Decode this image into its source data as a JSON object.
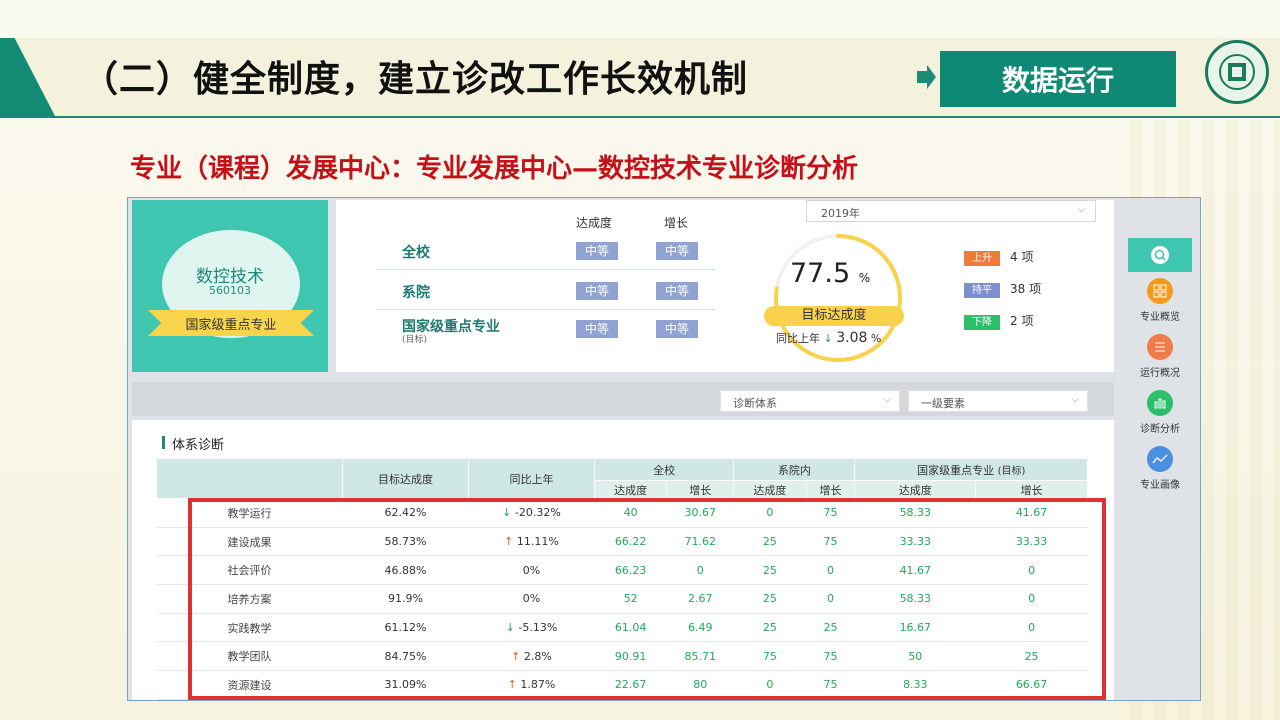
{
  "slide": {
    "title": "（二）健全制度，建立诊改工作长效机制",
    "badge": "数据运行",
    "subtitle": "专业（课程）发展中心：专业发展中心—数控技术专业诊断分析",
    "logo_icon": "school-seal-icon"
  },
  "major": {
    "name": "数控技术",
    "code": "560103",
    "ribbon": "国家级重点专业"
  },
  "levels": {
    "col_achieve": "达成度",
    "col_growth": "增长",
    "rows": [
      {
        "label": "全校",
        "sub": "",
        "achieve": "中等",
        "growth": "中等"
      },
      {
        "label": "系院",
        "sub": "",
        "achieve": "中等",
        "growth": "中等"
      },
      {
        "label": "国家级重点专业",
        "sub": "(目标)",
        "achieve": "中等",
        "growth": "中等"
      }
    ]
  },
  "year_select": {
    "value": "2019年"
  },
  "gauge": {
    "value": "77.5",
    "unit": "%",
    "label": "目标达成度",
    "yoy_prefix": "同比上年",
    "yoy_value": "3.08",
    "yoy_unit": "%",
    "fill_fraction": 0.775
  },
  "stats": [
    {
      "chip": "上升",
      "text": "4 项",
      "color": "#f07a3c"
    },
    {
      "chip": "持平",
      "text": "38 项",
      "color": "#7e8fd0"
    },
    {
      "chip": "下降",
      "text": "2 项",
      "color": "#2bbf6a"
    }
  ],
  "filters": {
    "system": "诊断体系",
    "level": "一级要素"
  },
  "section_title": "体系诊断",
  "table": {
    "h_target": "目标达成度",
    "h_yoy": "同比上年",
    "h_school": "全校",
    "h_dept": "系院内",
    "h_national": "国家级重点专业",
    "h_national_note": "(目标)",
    "h_achieve": "达成度",
    "h_growth": "增长",
    "rows": [
      {
        "name": "教学运行",
        "target": "62.42%",
        "dir": "down",
        "yoy": "-20.32%",
        "s_a": "40",
        "s_g": "30.67",
        "d_a": "0",
        "d_g": "75",
        "n_a": "58.33",
        "n_g": "41.67"
      },
      {
        "name": "建设成果",
        "target": "58.73%",
        "dir": "up",
        "yoy": "11.11%",
        "s_a": "66.22",
        "s_g": "71.62",
        "d_a": "25",
        "d_g": "75",
        "n_a": "33.33",
        "n_g": "33.33"
      },
      {
        "name": "社会评价",
        "target": "46.88%",
        "dir": "none",
        "yoy": "0%",
        "s_a": "66.23",
        "s_g": "0",
        "d_a": "25",
        "d_g": "0",
        "n_a": "41.67",
        "n_g": "0"
      },
      {
        "name": "培养方案",
        "target": "91.9%",
        "dir": "none",
        "yoy": "0%",
        "s_a": "52",
        "s_g": "2.67",
        "d_a": "25",
        "d_g": "0",
        "n_a": "58.33",
        "n_g": "0"
      },
      {
        "name": "实践教学",
        "target": "61.12%",
        "dir": "down",
        "yoy": "-5.13%",
        "s_a": "61.04",
        "s_g": "6.49",
        "d_a": "25",
        "d_g": "25",
        "n_a": "16.67",
        "n_g": "0"
      },
      {
        "name": "教学团队",
        "target": "84.75%",
        "dir": "up",
        "yoy": "2.8%",
        "s_a": "90.91",
        "s_g": "85.71",
        "d_a": "75",
        "d_g": "75",
        "n_a": "50",
        "n_g": "25"
      },
      {
        "name": "资源建设",
        "target": "31.09%",
        "dir": "up",
        "yoy": "1.87%",
        "s_a": "22.67",
        "s_g": "80",
        "d_a": "0",
        "d_g": "75",
        "n_a": "8.33",
        "n_g": "66.67"
      }
    ]
  },
  "side_nav": [
    {
      "label": "专业概览",
      "icon": "grid-icon",
      "color": "#f39a1e"
    },
    {
      "label": "运行概况",
      "icon": "list-icon",
      "color": "#f07a4a"
    },
    {
      "label": "诊断分析",
      "icon": "bar-chart-icon",
      "color": "#2bbf6a"
    },
    {
      "label": "专业画像",
      "icon": "trend-line-icon",
      "color": "#4a8fe0"
    }
  ]
}
